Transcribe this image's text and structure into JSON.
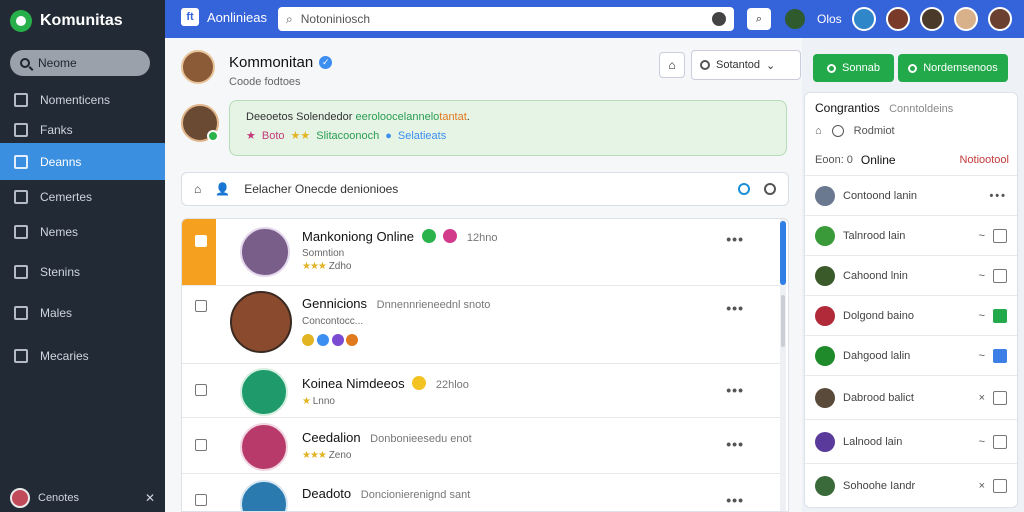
{
  "sidebar": {
    "brand": "Komunitas",
    "search_label": "Neome",
    "items": [
      {
        "label": "Nomenticens",
        "icon": "users-icon"
      },
      {
        "label": "Fanks",
        "icon": "people-icon"
      },
      {
        "label": "Deanns",
        "icon": "calendar-icon"
      },
      {
        "label": "Cemertes",
        "icon": "book-icon"
      },
      {
        "label": "Nemes",
        "icon": "notes-icon"
      },
      {
        "label": "Stenins",
        "icon": "settings-icon"
      },
      {
        "label": "Males",
        "icon": "team-icon"
      },
      {
        "label": "Mecaries",
        "icon": "media-icon"
      }
    ],
    "footer_label": "Cenotes"
  },
  "topbar": {
    "app_label": "Aonlinieas",
    "app_badge": "ft",
    "search_placeholder": "Notoniniosch",
    "status": "Olos"
  },
  "group": {
    "title": "Kommonitan",
    "subtitle": "Coode fodtoes",
    "status_button": "Sotantod"
  },
  "notice": {
    "line1_a": "Deeoetos Solendedor ",
    "line1_b": "eeroloocelannelo",
    "line1_c": "tantat",
    "line1_d": ".",
    "line2_a": "Boto",
    "line2_b": "Slitacoonoch",
    "line2_c": "Selatieats"
  },
  "post_input": {
    "placeholder": "Eelacher Onecde denionioes"
  },
  "feed": {
    "rows": [
      {
        "name": "Mankoniong Online",
        "meta": "12hno",
        "sub": "Somntion",
        "stars": "Zdho"
      },
      {
        "name": "Gennicions",
        "meta": "Dnnennrieneednl snoto",
        "sub": "Concontocc...",
        "stars": ""
      },
      {
        "name": "Koinea Nimdeeos",
        "meta": "22hloo",
        "sub": "",
        "stars": "Lnno"
      },
      {
        "name": "Ceedalion",
        "meta": "Donbonieesedu enot",
        "sub": "",
        "stars": "Zeno"
      },
      {
        "name": "Deadoto",
        "meta": "Doncionierenignd sant",
        "sub": "",
        "stars": ""
      }
    ]
  },
  "right": {
    "btn_online": "Sonnab",
    "btn_members": "Nordemsenoos",
    "panel_title": "Congrantios",
    "panel_sub": "Conntoldeins",
    "row2_label": "Rodmiot",
    "online_prefix": "Eoon: 0",
    "online_label": "Online",
    "notify": "Notiootool",
    "members": [
      {
        "name": "Contoond lanin",
        "action": "",
        "box": "dots"
      },
      {
        "name": "Talnrood lain",
        "action": "~",
        "box": "empty"
      },
      {
        "name": "Cahoond lnin",
        "action": "~",
        "box": "empty"
      },
      {
        "name": "Dolgond baino",
        "action": "~",
        "box": "green"
      },
      {
        "name": "Dahgood lalin",
        "action": "~",
        "box": "blue"
      },
      {
        "name": "Dabrood balict",
        "action": "×",
        "box": "empty"
      },
      {
        "name": "Lalnood lain",
        "action": "~",
        "box": "empty"
      },
      {
        "name": "Sohoohe Iandr",
        "action": "×",
        "box": "empty"
      }
    ]
  },
  "colors": {
    "sidebar_bg": "#222a35",
    "topbar_bg": "#3563d9",
    "accent_green": "#22a94a",
    "accent_blue": "#3a8fe0",
    "accent_orange": "#f5a01f"
  }
}
